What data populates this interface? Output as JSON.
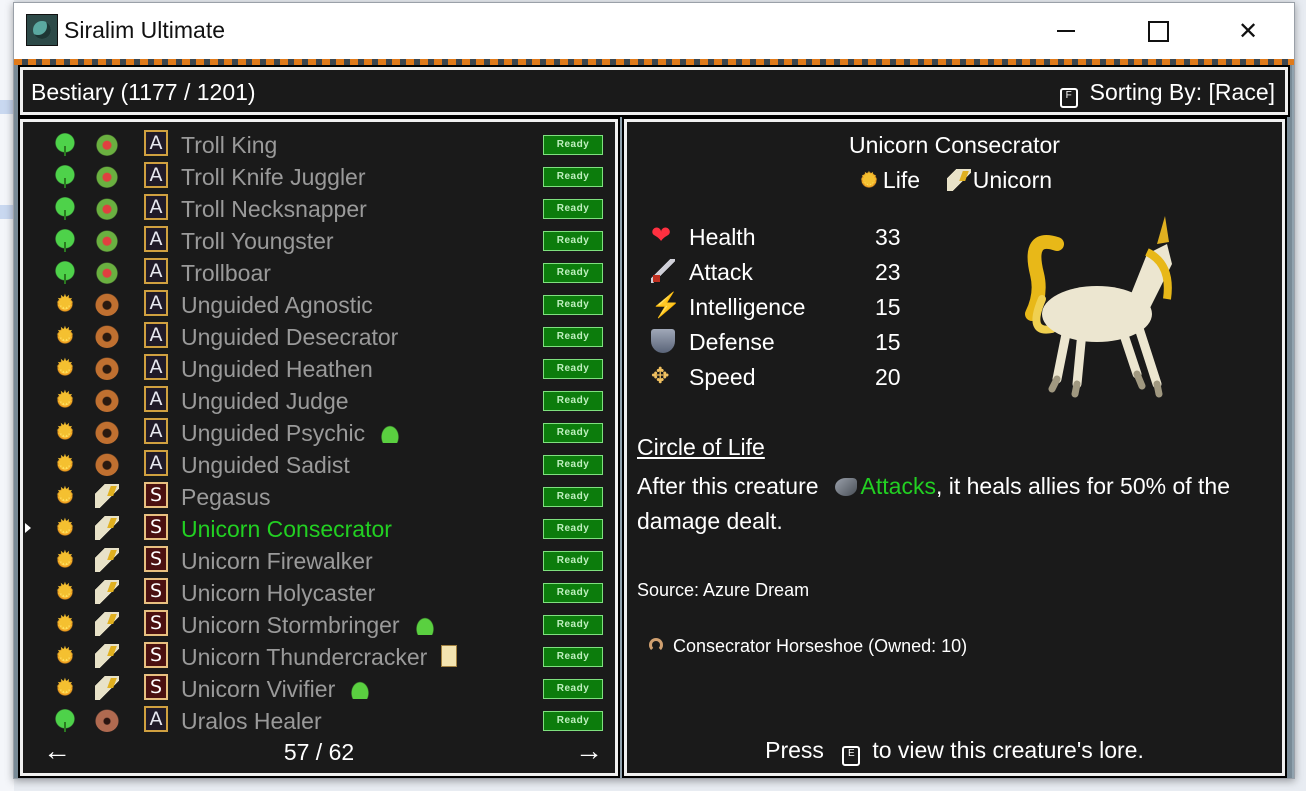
{
  "window": {
    "title": "Siralim Ultimate",
    "min_icon": "minimize-icon",
    "max_icon": "maximize-icon",
    "close_icon": "close-icon"
  },
  "header": {
    "title": "Bestiary (1177 / 1201)",
    "sort_key": "F",
    "sort_label": "Sorting By: [Race]"
  },
  "list": {
    "rows": [
      {
        "cls": "nature",
        "race": "troll",
        "badge": "A",
        "name": "Troll King",
        "extra": "",
        "status": "Ready"
      },
      {
        "cls": "nature",
        "race": "troll",
        "badge": "A",
        "name": "Troll Knife Juggler",
        "extra": "",
        "status": "Ready"
      },
      {
        "cls": "nature",
        "race": "troll",
        "badge": "A",
        "name": "Troll Necksnapper",
        "extra": "",
        "status": "Ready"
      },
      {
        "cls": "nature",
        "race": "troll",
        "badge": "A",
        "name": "Troll Youngster",
        "extra": "",
        "status": "Ready"
      },
      {
        "cls": "nature",
        "race": "troll",
        "badge": "A",
        "name": "Trollboar",
        "extra": "",
        "status": "Ready"
      },
      {
        "cls": "life",
        "race": "unguided",
        "badge": "A",
        "name": "Unguided Agnostic",
        "extra": "",
        "status": "Ready"
      },
      {
        "cls": "life",
        "race": "unguided",
        "badge": "A",
        "name": "Unguided Desecrator",
        "extra": "",
        "status": "Ready"
      },
      {
        "cls": "life",
        "race": "unguided",
        "badge": "A",
        "name": "Unguided Heathen",
        "extra": "",
        "status": "Ready"
      },
      {
        "cls": "life",
        "race": "unguided",
        "badge": "A",
        "name": "Unguided Judge",
        "extra": "",
        "status": "Ready"
      },
      {
        "cls": "life",
        "race": "unguided",
        "badge": "A",
        "name": "Unguided Psychic",
        "extra": "slime",
        "status": "Ready"
      },
      {
        "cls": "life",
        "race": "unguided",
        "badge": "A",
        "name": "Unguided Sadist",
        "extra": "",
        "status": "Ready"
      },
      {
        "cls": "life",
        "race": "unicorn",
        "badge": "S",
        "name": "Pegasus",
        "extra": "",
        "status": "Ready"
      },
      {
        "cls": "life",
        "race": "unicorn",
        "badge": "S",
        "name": "Unicorn Consecrator",
        "extra": "",
        "status": "Ready",
        "selected": true
      },
      {
        "cls": "life",
        "race": "unicorn",
        "badge": "S",
        "name": "Unicorn Firewalker",
        "extra": "",
        "status": "Ready"
      },
      {
        "cls": "life",
        "race": "unicorn",
        "badge": "S",
        "name": "Unicorn Holycaster",
        "extra": "",
        "status": "Ready"
      },
      {
        "cls": "life",
        "race": "unicorn",
        "badge": "S",
        "name": "Unicorn Stormbringer",
        "extra": "slime",
        "status": "Ready"
      },
      {
        "cls": "life",
        "race": "unicorn",
        "badge": "S",
        "name": "Unicorn Thundercracker",
        "extra": "card",
        "status": "Ready"
      },
      {
        "cls": "life",
        "race": "unicorn",
        "badge": "S",
        "name": "Unicorn Vivifier",
        "extra": "slime",
        "status": "Ready"
      },
      {
        "cls": "nature",
        "race": "uralos",
        "badge": "A",
        "name": "Uralos Healer",
        "extra": "",
        "status": "Ready"
      }
    ],
    "page": "57 / 62"
  },
  "detail": {
    "name": "Unicorn Consecrator",
    "class_label": "Life",
    "race_label": "Unicorn",
    "stats": [
      {
        "icon": "heart-icon",
        "label": "Health",
        "value": "33"
      },
      {
        "icon": "sword-icon",
        "label": "Attack",
        "value": "23"
      },
      {
        "icon": "lightning-icon",
        "label": "Intelligence",
        "value": "15"
      },
      {
        "icon": "shield-icon",
        "label": "Defense",
        "value": "15"
      },
      {
        "icon": "wing-icon",
        "label": "Speed",
        "value": "20"
      }
    ],
    "trait_title": "Circle of Life",
    "trait_pre": "After this creature",
    "trait_keyword": "Attacks",
    "trait_post": ", it heals allies for 50% of the damage dealt.",
    "source": "Source: Azure Dream",
    "material": "Consecrator Horseshoe (Owned: 10)",
    "lore_pre": "Press",
    "lore_key": "E",
    "lore_post": "to view this creature's lore."
  }
}
